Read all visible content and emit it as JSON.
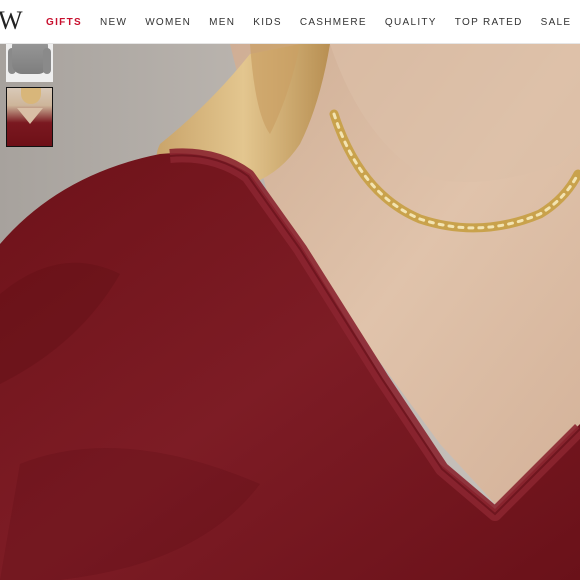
{
  "brand": {
    "logo_text": "W"
  },
  "nav": {
    "items": [
      {
        "label": "GIFTS",
        "accent": true
      },
      {
        "label": "NEW"
      },
      {
        "label": "WOMEN"
      },
      {
        "label": "MEN"
      },
      {
        "label": "KIDS"
      },
      {
        "label": "CASHMERE"
      },
      {
        "label": "QUALITY"
      },
      {
        "label": "TOP RATED"
      },
      {
        "label": "SALE"
      }
    ],
    "accent_color": "#c8102e"
  },
  "gallery": {
    "thumbnails": [
      {
        "name": "gray sweater thumbnail",
        "selected": false
      },
      {
        "name": "burgundy sweater thumbnail",
        "selected": true
      }
    ]
  },
  "hero": {
    "subject": "model wearing burgundy V-neck cashmere sweater with gold necklace",
    "colors": {
      "sweater": "#7a1a22",
      "background": "#b9b3ad",
      "skin": "#d9bba3",
      "hair": "#d6b57a"
    }
  }
}
